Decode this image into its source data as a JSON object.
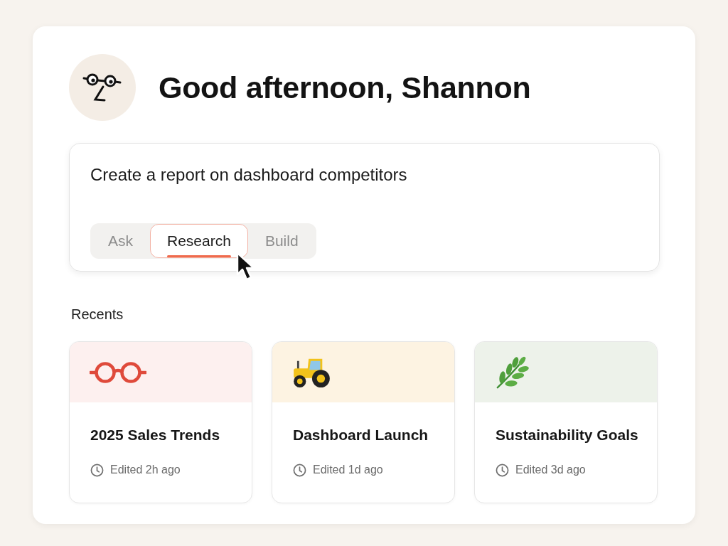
{
  "greeting": {
    "title": "Good afternoon, Shannon"
  },
  "prompt": {
    "value": "Create a report on dashboard competitors",
    "modes": [
      {
        "label": "Ask",
        "selected": false
      },
      {
        "label": "Research",
        "selected": true
      },
      {
        "label": "Build",
        "selected": false
      }
    ]
  },
  "recents": {
    "heading": "Recents",
    "items": [
      {
        "title": "2025 Sales Trends",
        "edited": "Edited 2h ago",
        "color": "#fdf0ef"
      },
      {
        "title": "Dashboard Launch",
        "edited": "Edited 1d ago",
        "color": "#fdf3e2"
      },
      {
        "title": "Sustainability Goals",
        "edited": "Edited 3d ago",
        "color": "#edf2ea"
      }
    ]
  }
}
